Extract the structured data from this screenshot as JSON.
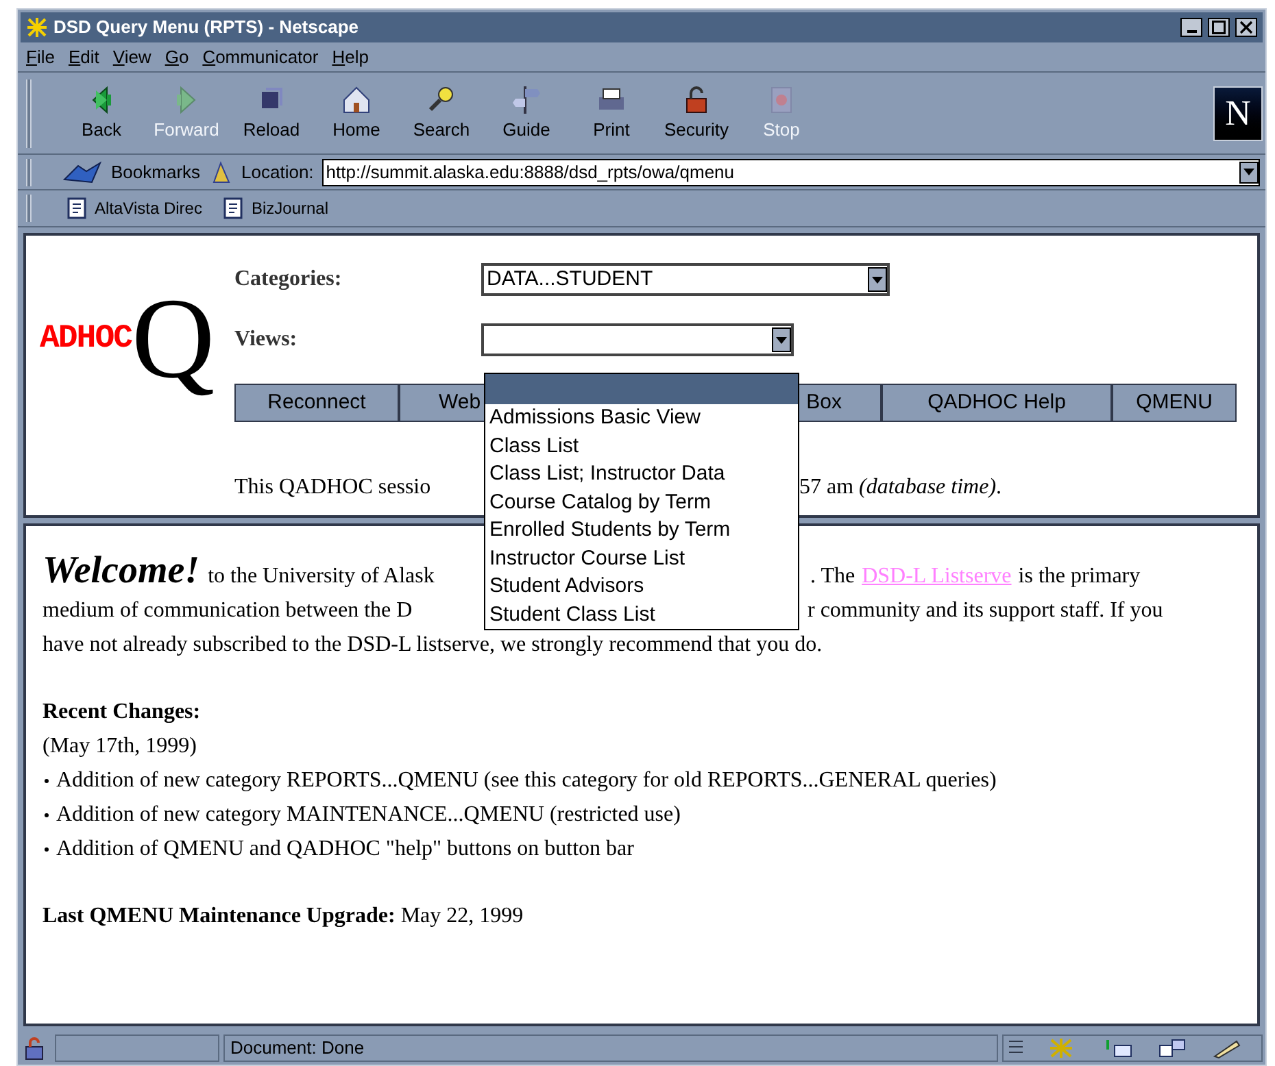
{
  "window": {
    "title": "DSD Query Menu (RPTS) - Netscape"
  },
  "menu": [
    "File",
    "Edit",
    "View",
    "Go",
    "Communicator",
    "Help"
  ],
  "toolbar": [
    {
      "label": "Back",
      "kind": "back",
      "disabled": false
    },
    {
      "label": "Forward",
      "kind": "forward",
      "disabled": true
    },
    {
      "label": "Reload",
      "kind": "reload",
      "disabled": false
    },
    {
      "label": "Home",
      "kind": "home",
      "disabled": false
    },
    {
      "label": "Search",
      "kind": "search",
      "disabled": false
    },
    {
      "label": "Guide",
      "kind": "guide",
      "disabled": false
    },
    {
      "label": "Print",
      "kind": "print",
      "disabled": false
    },
    {
      "label": "Security",
      "kind": "security",
      "disabled": false
    },
    {
      "label": "Stop",
      "kind": "stop",
      "disabled": true
    }
  ],
  "brand_logo": "N",
  "location_bar": {
    "bookmarks": "Bookmarks",
    "label": "Location:",
    "url": "http://summit.alaska.edu:8888/dsd_rpts/owa/qmenu"
  },
  "personal_bar": [
    "AltaVista Direc",
    "BizJournal"
  ],
  "top_frame": {
    "logo": {
      "letter": "Q",
      "word": "ADHOC"
    },
    "categories": {
      "label": "Categories:",
      "value": "DATA...STUDENT"
    },
    "views": {
      "label": "Views:",
      "dropdown_open": true,
      "blank_option_selected": true,
      "options": [
        {
          "label": "Admissions Basic View",
          "selected": false
        },
        {
          "label": "Class List",
          "selected": false
        },
        {
          "label": "Class List; Instructor Data",
          "selected": false
        },
        {
          "label": "Course Catalog by Term",
          "selected": false
        },
        {
          "label": "Enrolled Students by Term",
          "selected": false
        },
        {
          "label": "Instructor Course List",
          "selected": false
        },
        {
          "label": "Student Advisors",
          "selected": false
        },
        {
          "label": "Student Class List",
          "selected": false
        }
      ]
    },
    "buttons": [
      "Reconnect",
      "Web",
      "Box",
      "QADHOC Help",
      "QMENU"
    ],
    "session_text": [
      "This QADHOC sessio",
      "57 am *(database time)*."
    ]
  },
  "bottom_frame": {
    "welcome": "Welcome!",
    "line_1": [
      "to the University of Alask",
      ". The"
    ],
    "link": "DSD-L Listserve",
    "line_1_end": "is the primary",
    "line_2": [
      "medium of communication between the D",
      "r community and its support staff. If you"
    ],
    "line_3": "have not already subscribed to the DSD-L listserve, we strongly recommend that you do.",
    "recent_changes": "**Recent Changes:**",
    "date": "(May 17th, 1999)",
    "changes": [
      "Addition of new category REPORTS...QMENU (see this category for old REPORTS...GENERAL queries)",
      "Addition of new category MAINTENANCE...QMENU (restricted use)",
      "Addition of QMENU and QADHOC \"help\" buttons on button bar"
    ],
    "last_upgrade": "**Last QMENU Maintenance Upgrade:** May 22, 1999"
  },
  "status_bar": {
    "text": "Document: Done"
  }
}
